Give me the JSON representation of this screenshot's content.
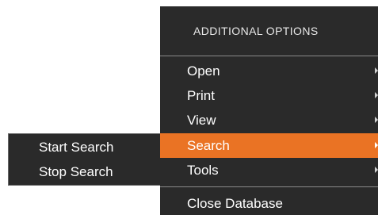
{
  "menu": {
    "header": "ADDITIONAL OPTIONS",
    "items": [
      {
        "label": "Open",
        "has_submenu": true
      },
      {
        "label": "Print",
        "has_submenu": true
      },
      {
        "label": "View",
        "has_submenu": true
      },
      {
        "label": "Search",
        "has_submenu": true,
        "active": true
      },
      {
        "label": "Tools",
        "has_submenu": true
      }
    ],
    "footer_item": "Close Database"
  },
  "submenu": {
    "items": [
      {
        "label": "Start Search"
      },
      {
        "label": "Stop Search"
      }
    ]
  },
  "colors": {
    "menu_bg": "#2a2a2a",
    "active_bg": "#ea7324",
    "text": "#ffffff",
    "divider": "#8a8a8a"
  }
}
